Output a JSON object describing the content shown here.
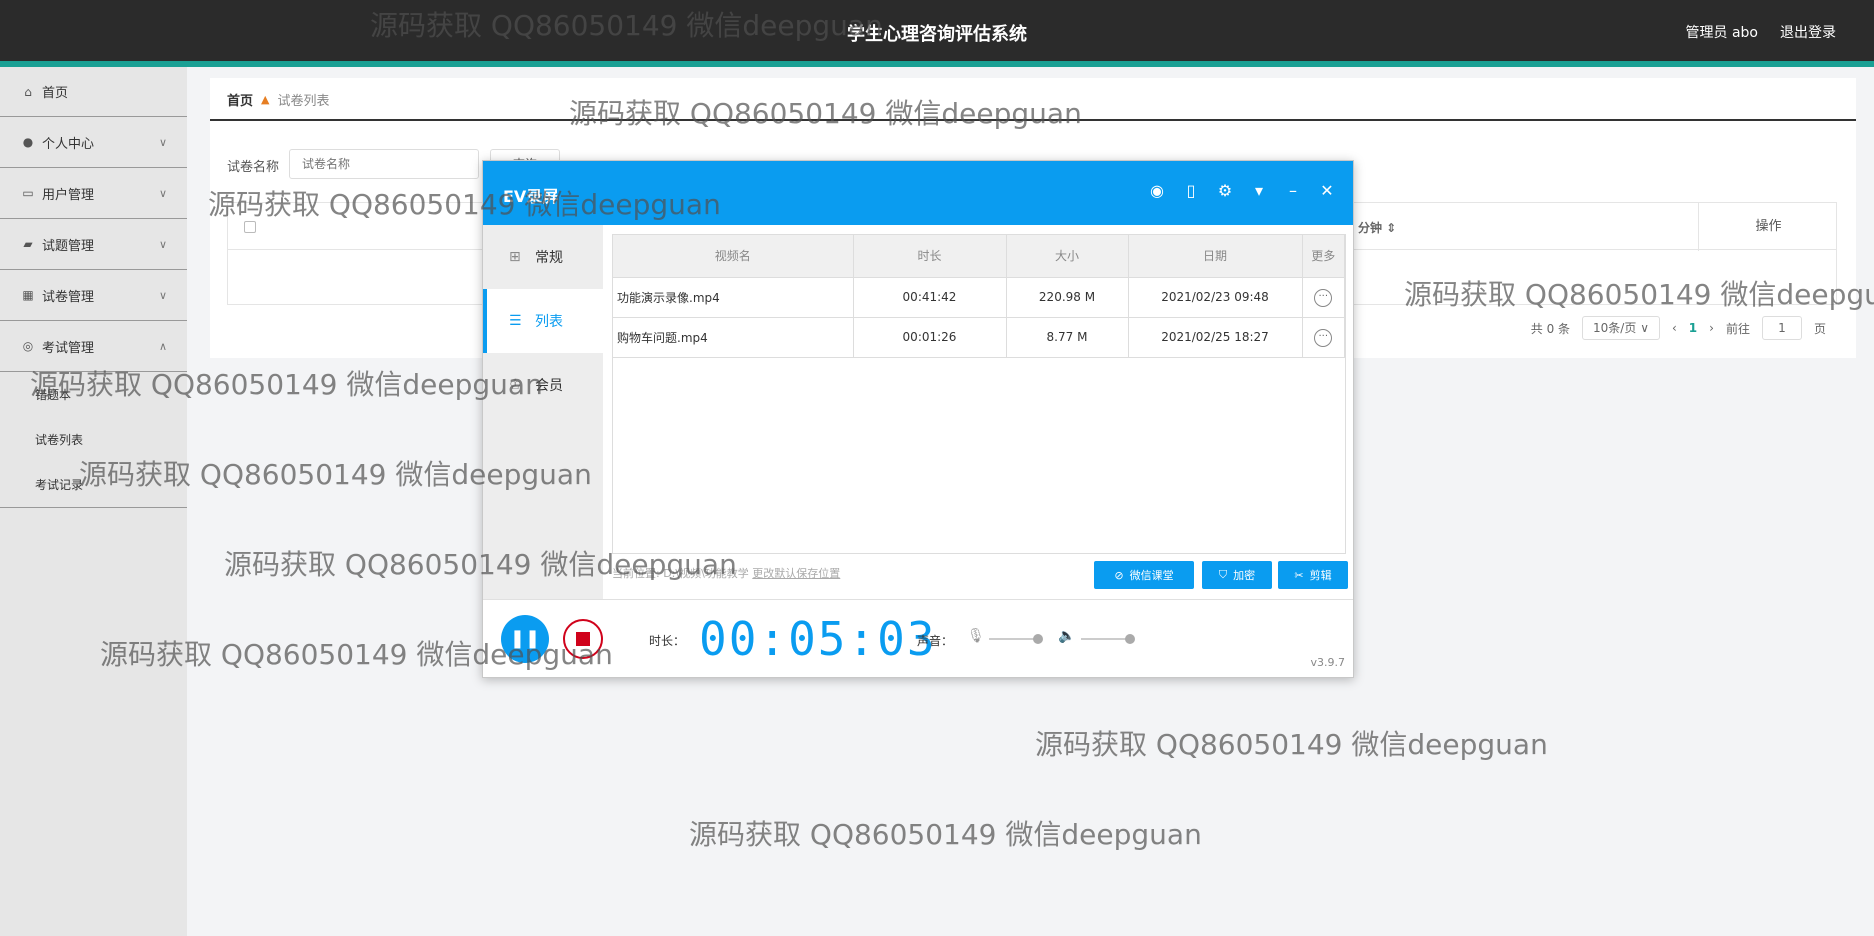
{
  "header": {
    "title": "学生心理咨询评估系统",
    "user": "管理员 abo",
    "logout": "退出登录",
    "accent_color": "#1aa094"
  },
  "sidebar": {
    "items": [
      {
        "label": "首页",
        "icon": "home-icon"
      },
      {
        "label": "个人中心",
        "icon": "person-icon"
      },
      {
        "label": "用户管理",
        "icon": "id-card-icon"
      },
      {
        "label": "试题管理",
        "icon": "briefcase-icon"
      },
      {
        "label": "试卷管理",
        "icon": "grid-icon"
      },
      {
        "label": "考试管理",
        "icon": "settings-icon"
      }
    ],
    "subitems": [
      "错题本",
      "试卷列表",
      "考试记录"
    ]
  },
  "main": {
    "breadcrumb": {
      "home": "首页",
      "current": "试卷列表"
    },
    "search": {
      "label": "试卷名称",
      "placeholder": "试卷名称",
      "button": "查询"
    },
    "table": {
      "col_minutes": "分钟",
      "col_ops": "操作"
    },
    "pager": {
      "total": "共 0 条",
      "page_size": "10条/页",
      "current": "1",
      "goto": "前往",
      "goto_value": "1",
      "page_unit": "页"
    }
  },
  "ev": {
    "title": "EV录屏",
    "tabs": [
      "常规",
      "列表",
      "会员"
    ],
    "columns": [
      "视频名",
      "时长",
      "大小",
      "日期",
      "更多"
    ],
    "rows": [
      {
        "name": "功能演示录像.mp4",
        "duration": "00:41:42",
        "size": "220.98 M",
        "date": "2021/02/23 09:48"
      },
      {
        "name": "购物车问题.mp4",
        "duration": "00:01:26",
        "size": "8.77 M",
        "date": "2021/02/25 18:27"
      }
    ],
    "path_label": "当前位置: D:\\视频\\功能教学",
    "change_path": "更改默认保存位置",
    "buttons": {
      "wechat": "微信课堂",
      "encrypt": "加密",
      "edit": "剪辑"
    },
    "duration_label": "时长：",
    "timer": "00:05:03",
    "volume_label": "声音：",
    "version": "v3.9.7",
    "accent_color": "#0a9cf0"
  },
  "watermark": "源码获取 QQ86050149 微信deepguan"
}
